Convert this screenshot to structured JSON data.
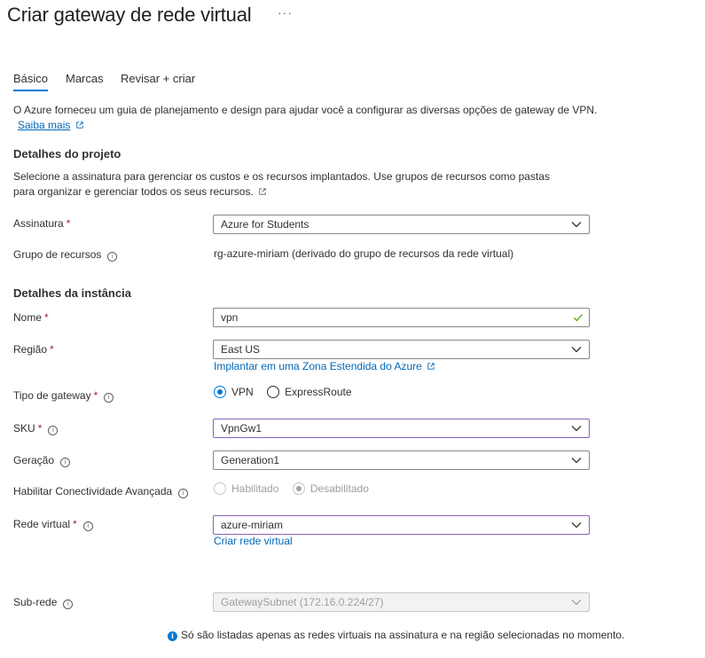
{
  "header": {
    "title": "Criar gateway de rede virtual",
    "more": "···"
  },
  "tabs": [
    {
      "label": "Básico"
    },
    {
      "label": "Marcas"
    },
    {
      "label": "Revisar + criar"
    }
  ],
  "intro": {
    "text": "O Azure forneceu um guia de planejamento e design para ajudar você a configurar as diversas opções de gateway de VPN.",
    "link": "Saiba mais"
  },
  "project": {
    "heading": "Detalhes do projeto",
    "description": "Selecione a assinatura para gerenciar os custos e os recursos implantados. Use grupos de recursos como pastas para organizar e gerenciar todos os seus recursos.",
    "subscription_label": "Assinatura",
    "subscription_value": "Azure for Students",
    "resource_group_label": "Grupo de recursos",
    "resource_group_value": "rg-azure-miriam (derivado do grupo de recursos da rede virtual)"
  },
  "instance": {
    "heading": "Detalhes da instância",
    "name_label": "Nome",
    "name_value": "vpn",
    "region_label": "Região",
    "region_value": "East US",
    "region_link": "Implantar em uma Zona Estendida do Azure",
    "gateway_type_label": "Tipo de gateway",
    "gateway_type_options": [
      "VPN",
      "ExpressRoute"
    ],
    "gateway_type_selected": "VPN",
    "sku_label": "SKU",
    "sku_value": "VpnGw1",
    "generation_label": "Geração",
    "generation_value": "Generation1",
    "advanced_label": "Habilitar Conectividade Avançada",
    "advanced_options": [
      "Habilitado",
      "Desabilitado"
    ],
    "advanced_selected": "Desabilitado",
    "vnet_label": "Rede virtual",
    "vnet_value": "azure-miriam",
    "vnet_link": "Criar rede virtual",
    "subnet_label": "Sub-rede",
    "subnet_value": "GatewaySubnet (172.16.0.224/27)",
    "note": "Só são listadas apenas as redes virtuais na assinatura e na região selecionadas no momento."
  },
  "colors": {
    "accent": "#0078d4",
    "link": "#0067b8",
    "required": "#a4262c",
    "focus_border": "#8764b8",
    "valid": "#57a300"
  }
}
